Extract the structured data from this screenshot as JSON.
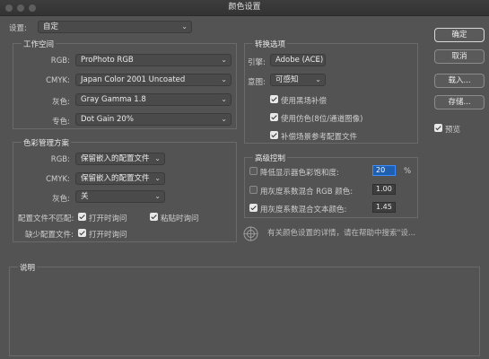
{
  "window": {
    "title": "颜色设置"
  },
  "settings": {
    "label": "设置:",
    "value": "自定"
  },
  "working_spaces": {
    "title": "工作空间",
    "rows": [
      {
        "label": "RGB:",
        "value": "ProPhoto RGB"
      },
      {
        "label": "CMYK:",
        "value": "Japan Color 2001 Uncoated"
      },
      {
        "label": "灰色:",
        "value": "Gray Gamma 1.8"
      },
      {
        "label": "专色:",
        "value": "Dot Gain 20%"
      }
    ]
  },
  "policies": {
    "title": "色彩管理方案",
    "rows": [
      {
        "label": "RGB:",
        "value": "保留嵌入的配置文件"
      },
      {
        "label": "CMYK:",
        "value": "保留嵌入的配置文件"
      },
      {
        "label": "灰色:",
        "value": "关"
      }
    ],
    "mismatch_label": "配置文件不匹配:",
    "ask_open": {
      "label": "打开时询问",
      "checked": true
    },
    "ask_paste": {
      "label": "粘贴时询问",
      "checked": true
    },
    "missing_label": "缺少配置文件:",
    "missing_ask_open": {
      "label": "打开时询问",
      "checked": true
    }
  },
  "conversion": {
    "title": "转换选项",
    "engine_label": "引擎:",
    "engine_value": "Adobe (ACE)",
    "intent_label": "意图:",
    "intent_value": "可感知",
    "black_point": {
      "label": "使用黑场补偿",
      "checked": true
    },
    "dither": {
      "label": "使用仿色(8位/通道图像)",
      "checked": true
    },
    "compensate": {
      "label": "补偿场景参考配置文件",
      "checked": true
    }
  },
  "advanced": {
    "title": "高级控制",
    "desaturate": {
      "label": "降低显示器色彩饱和度:",
      "checked": false,
      "value": "20",
      "unit": "%"
    },
    "blend_rgb": {
      "label": "用灰度系数混合 RGB 颜色:",
      "checked": false,
      "value": "1.00"
    },
    "blend_text": {
      "label": "用灰度系数混合文本颜色:",
      "checked": true,
      "value": "1.45"
    }
  },
  "info_text": "有关颜色设置的详情，请在帮助中搜索\"设...",
  "description": {
    "title": "说明"
  },
  "buttons": {
    "ok": "确定",
    "cancel": "取消",
    "load": "载入...",
    "save": "存储..."
  },
  "preview": {
    "label": "预览",
    "checked": true
  },
  "colors": {
    "background": "#535353",
    "highlight": "#1f5fb0"
  }
}
